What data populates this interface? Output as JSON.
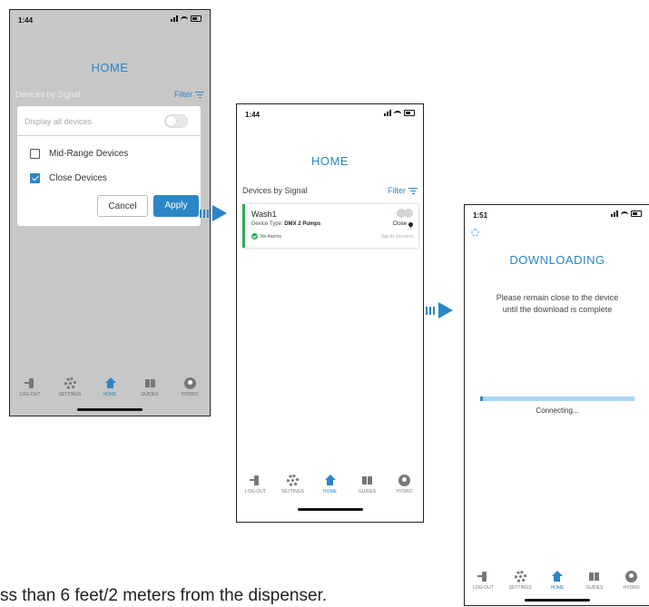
{
  "status": {
    "time1": "1:44",
    "time2": "1:44",
    "time3": "1:51"
  },
  "home": {
    "title": "HOME",
    "devices_by_signal": "Devices by Signal",
    "filter_label": "Filter"
  },
  "filter_modal": {
    "display_all": "Display all devices",
    "mid_range": "Mid-Range Devices",
    "close_devices": "Close Devices",
    "mid_range_checked": false,
    "close_checked": true,
    "cancel": "Cancel",
    "apply": "Apply"
  },
  "device": {
    "name": "Wash1",
    "type_label": "Device Type:",
    "type_value": "DMX 2 Pumps",
    "alarms": "No Alarms",
    "proximity": "Close",
    "tap": "Tap to connect"
  },
  "download": {
    "title": "DOWNLOADING",
    "message_line1": "Please remain close to the device",
    "message_line2": "until the download is complete",
    "progress": 0.02,
    "status": "Connecting..."
  },
  "tabs": [
    {
      "label": "LOG-OUT",
      "icon": "logout-icon"
    },
    {
      "label": "SETTINGS",
      "icon": "gear-icon"
    },
    {
      "label": "HOME",
      "icon": "home-icon"
    },
    {
      "label": "GUIDES",
      "icon": "book-icon"
    },
    {
      "label": "HYDRO",
      "icon": "hydro-icon"
    }
  ],
  "colors": {
    "accent": "#2a86c8",
    "ok": "#2faa5a",
    "dim_overlay": "#c7c7c7"
  },
  "caption": "ss than 6 feet/2 meters from the dispenser."
}
